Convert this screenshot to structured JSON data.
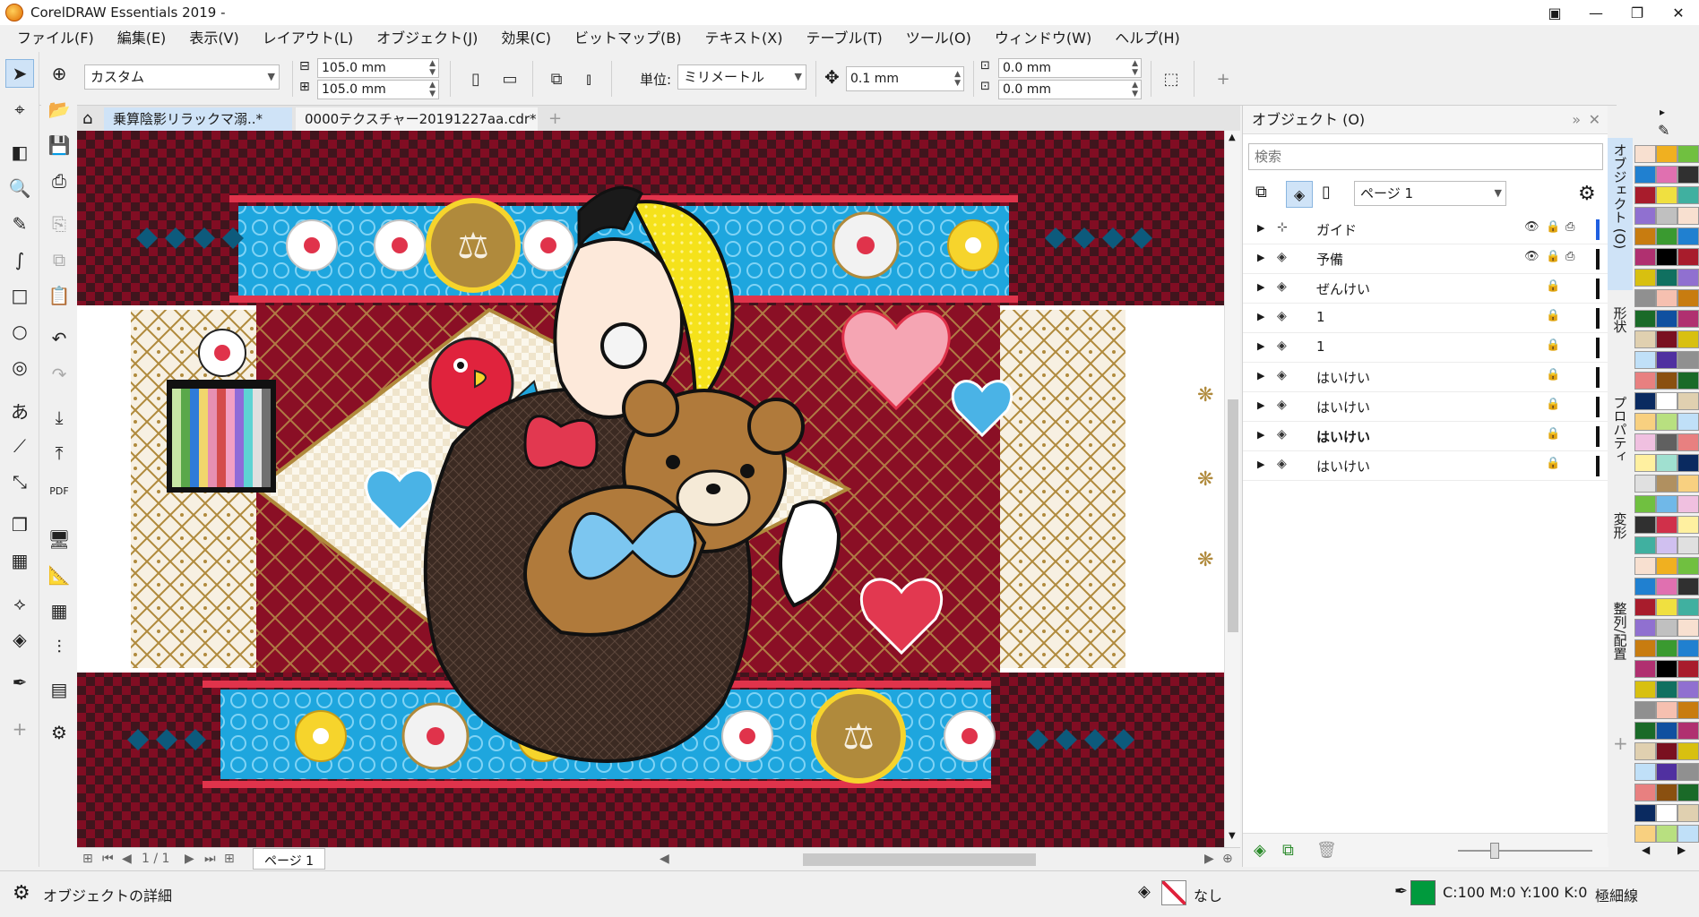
{
  "titlebar": {
    "title": "CorelDRAW Essentials 2019 -"
  },
  "menu": [
    "ファイル(F)",
    "編集(E)",
    "表示(V)",
    "レイアウト(L)",
    "オブジェクト(J)",
    "効果(C)",
    "ビットマップ(B)",
    "テキスト(X)",
    "テーブル(T)",
    "ツール(O)",
    "ウィンドウ(W)",
    "ヘルプ(H)"
  ],
  "propbar": {
    "page_size": "カスタム",
    "width": "105.0 mm",
    "height": "105.0 mm",
    "units_label": "単位:",
    "units": "ミリメートル",
    "nudge": "0.1 mm",
    "dup_x": "0.0 mm",
    "dup_y": "0.0 mm"
  },
  "tabs": [
    "乗算陰影リラックマ溺..*",
    "0000テクスチャー20191227aa.cdr*"
  ],
  "pagenav": {
    "counter": "1 / 1",
    "page_tab": "ページ 1"
  },
  "docker": {
    "title": "オブジェクト (O)",
    "search_placeholder": "検索",
    "page_select": "ページ 1",
    "layers": [
      {
        "name": "ガイド",
        "bar": "#1f5fe0"
      },
      {
        "name": "予備",
        "bar": "#111111"
      },
      {
        "name": "ぜんけい",
        "bar": "#111111"
      },
      {
        "name": "1",
        "bar": "#111111"
      },
      {
        "name": "1",
        "bar": "#111111"
      },
      {
        "name": "はいけい",
        "bar": "#111111"
      },
      {
        "name": "はいけい",
        "bar": "#111111"
      },
      {
        "name": "はいけい",
        "bar": "#111111"
      },
      {
        "name": "はいけい",
        "bar": "#111111"
      }
    ]
  },
  "sidetabs": [
    "オブジェクト (O)",
    "形状",
    "プロパティ",
    "変形",
    "整列/配置"
  ],
  "status": {
    "left": "オブジェクトの詳細",
    "fill": "なし",
    "outline": "C:100 M:0 Y:100 K:0",
    "outline_width": "極細線"
  },
  "colors": {
    "bg_red": "#8a0f25",
    "band_blue": "#1ea6de",
    "diamond_navy": "#0d5a7c",
    "gold": "#b08a3c",
    "cream": "#f7f0e2"
  }
}
